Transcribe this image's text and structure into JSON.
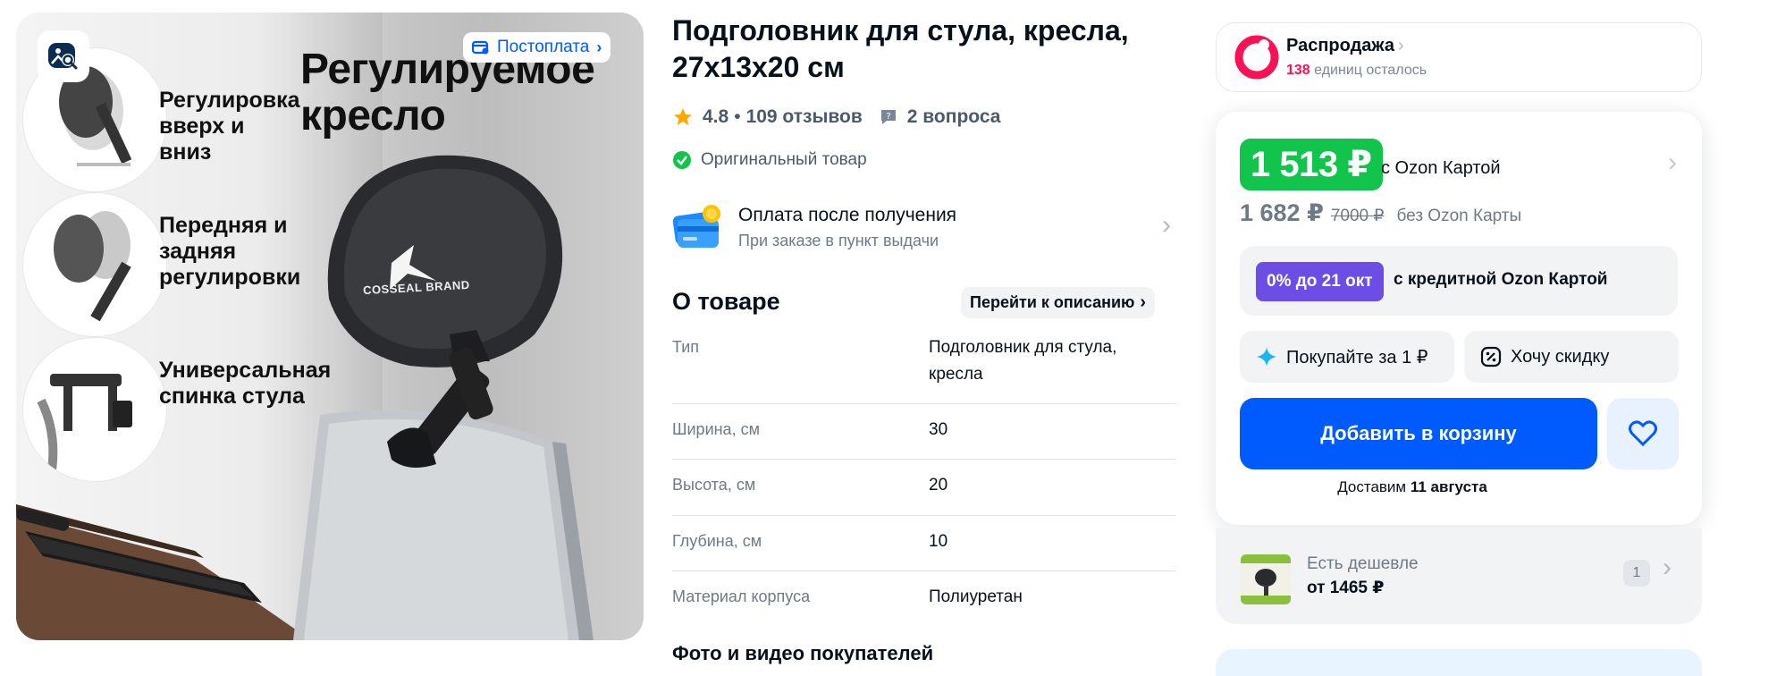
{
  "gallery": {
    "postpay_badge": "Постоплата",
    "headline": "Регулируемое кресло",
    "features": [
      "Регулировка вверх и вниз",
      "Передняя и задняя регулировки",
      "Универсальная спинка стула"
    ],
    "brand_text": "COSSEAL BRAND"
  },
  "product": {
    "title": "Подголовник для стула, кресла, 27x13x20 см",
    "rating": "4.8",
    "reviews": "109 отзывов",
    "questions": "2 вопроса",
    "original": "Оригинальный товар",
    "payment_title": "Оплата после получения",
    "payment_sub": "При заказе в пункт выдачи"
  },
  "about": {
    "title": "О товаре",
    "goto_label": "Перейти к описанию",
    "specs": [
      {
        "key": "Тип",
        "value": "Подголовник для стула, кресла"
      },
      {
        "key": "Ширина, см",
        "value": "30"
      },
      {
        "key": "Высота, см",
        "value": "20"
      },
      {
        "key": "Глубина, см",
        "value": "10"
      },
      {
        "key": "Материал корпуса",
        "value": "Полиуретан"
      }
    ],
    "photos_title": "Фото и видео покупателей"
  },
  "sale": {
    "title": "Распродажа",
    "count": "138",
    "count_suffix": "единиц осталось",
    "colors": {
      "accent": "#f91155"
    }
  },
  "price": {
    "card_price": "1 513 ₽",
    "card_label": "с Ozon Картой",
    "regular_price": "1 682 ₽",
    "old_price": "7000 ₽",
    "regular_label": "без Ozon Карты",
    "credit_badge": "0% до 21 окт",
    "credit_label": "с кредитной Ozon Картой",
    "buy_for_label": "Покупайте за 1 ₽",
    "discount_label": "Хочу скидку",
    "cart_label": "Добавить в корзину",
    "delivery_prefix": "Доставим",
    "delivery_date": "11 августа",
    "colors": {
      "green": "#10c44c",
      "blue": "#005bff",
      "purple": "#6c4ee6"
    }
  },
  "cheaper": {
    "title": "Есть дешевле",
    "price": "от 1465 ₽",
    "count": "1"
  }
}
